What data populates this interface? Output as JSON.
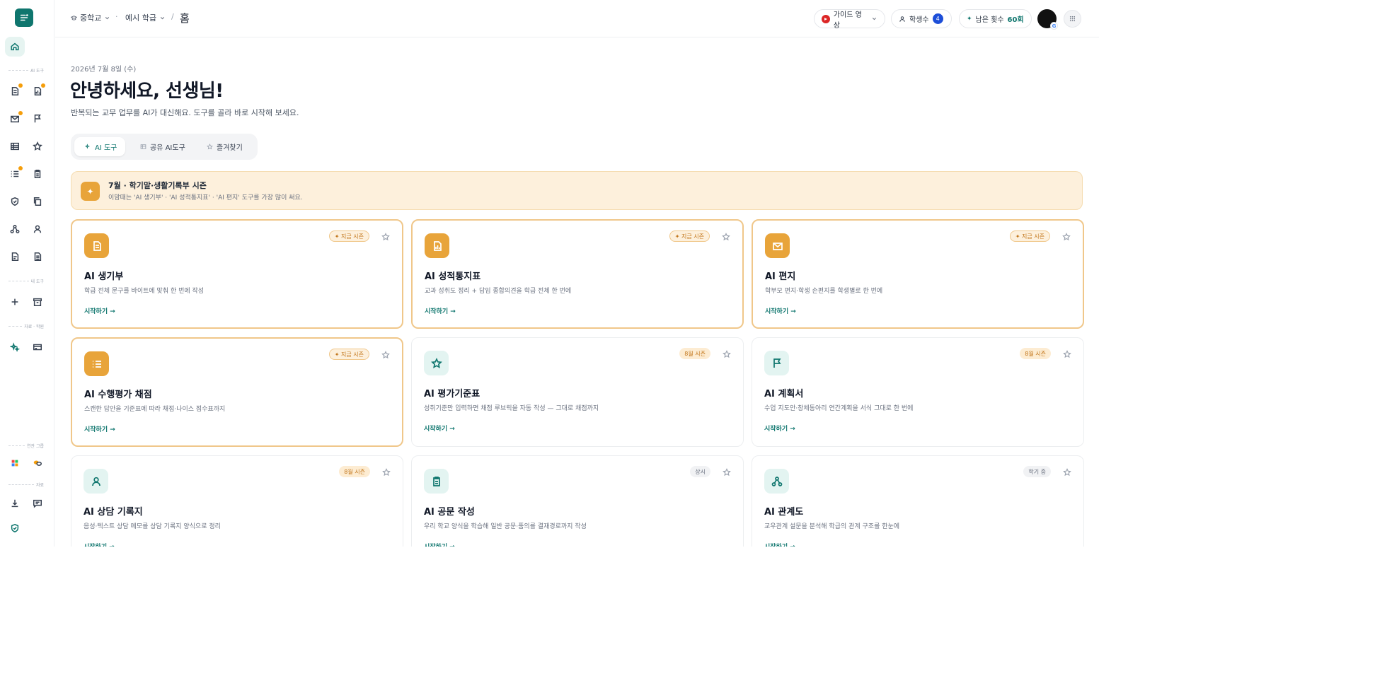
{
  "breadcrumb": {
    "school": "중학교",
    "class": "예시 학급",
    "separator": "/",
    "page": "홈"
  },
  "header": {
    "guide_label": "가이드 영상",
    "students_label": "학생수",
    "students_count": "4",
    "remaining_label": "남은 횟수",
    "remaining_value": "60회"
  },
  "sidebar": {
    "section_ai": "AI 도구",
    "section_mine": "내 도구",
    "section_misc": "자료 · 학원",
    "section_group": "연관 그룹",
    "section_etc": "자료"
  },
  "main": {
    "date": "2026년 7월 8일 (수)",
    "greeting": "안녕하세요, 선생님!",
    "subtitle": "반복되는 교무 업무를 AI가 대신해요. 도구를 골라 바로 시작해 보세요.",
    "tabs": [
      {
        "label": "AI 도구"
      },
      {
        "label": "공유 AI도구"
      },
      {
        "label": "즐겨찾기"
      }
    ],
    "banner": {
      "title": "7월 · 학기말·생활기록부 시즌",
      "desc": "이맘때는 'AI 생기부' · 'AI 성적통지표' · 'AI 편지' 도구를 가장 많이 써요."
    },
    "start_label": "시작하기 →",
    "cards": [
      {
        "title": "AI 생기부",
        "desc": "학급 전체 문구를 바이트에 맞춰 한 번에 작성",
        "badge": "지금 시즌",
        "icon": "document-icon"
      },
      {
        "title": "AI 성적통지표",
        "desc": "교과 성취도 정리 + 담임 종합의견을 학급 전체 한 번에",
        "badge": "지금 시즌",
        "icon": "report-icon"
      },
      {
        "title": "AI 편지",
        "desc": "학부모 편지·학생 손편지를 학생별로 한 번에",
        "badge": "지금 시즌",
        "icon": "mail-icon"
      },
      {
        "title": "AI 수행평가 채점",
        "desc": "스캔한 답안을 기준표에 따라 채점·나이스 점수표까지",
        "badge": "지금 시즌",
        "icon": "checklist-icon"
      },
      {
        "title": "AI 평가기준표",
        "desc": "성취기준만 입력하면 채점 루브릭을 자동 작성 — 그대로 채점까지",
        "badge": "8월 시즌",
        "icon": "star-outline-icon"
      },
      {
        "title": "AI 계획서",
        "desc": "수업 지도안·창체동아리 연간계획을 서식 그대로 한 번에",
        "badge": "8월 시즌",
        "icon": "flag-icon"
      },
      {
        "title": "AI 상담 기록지",
        "desc": "음성·텍스트 상담 메모를 상담 기록지 양식으로 정리",
        "badge": "8월 시즌",
        "icon": "person-icon"
      },
      {
        "title": "AI 공문 작성",
        "desc": "우리 학교 양식을 학습해 일반 공문·품의를 결재경로까지 작성",
        "badge": "상시",
        "icon": "clipboard-icon"
      },
      {
        "title": "AI 관계도",
        "desc": "교우관계 설문을 분석해 학급의 관계 구조를 한눈에",
        "badge": "학기 중",
        "icon": "network-icon"
      }
    ]
  },
  "colors": {
    "brand": "#0f766e",
    "accent_orange": "#e8a43a",
    "banner_bg": "#fdf0dc"
  }
}
